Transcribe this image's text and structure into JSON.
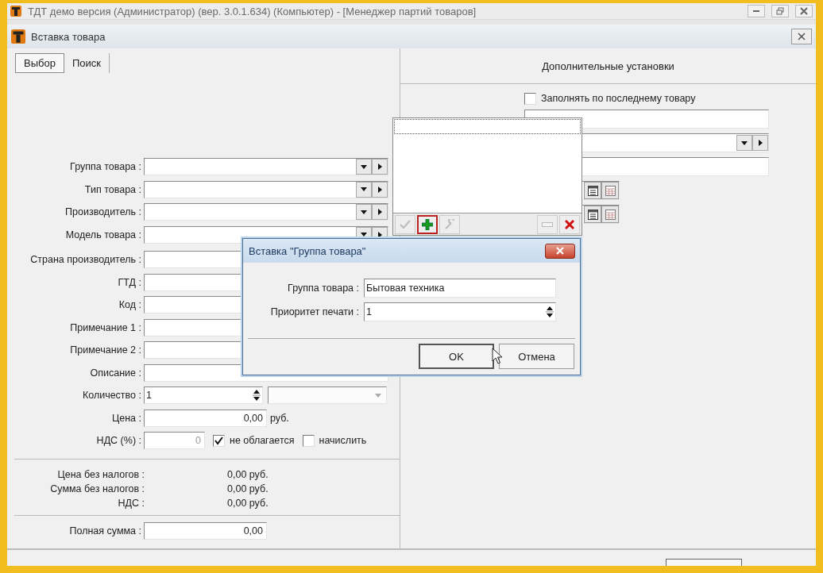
{
  "app_window": {
    "title": "ТДТ демо версия  (Администратор) (вер. 3.0.1.634) (Компьютер) - [Менеджер партий товаров]"
  },
  "dialog": {
    "title": "Вставка товара"
  },
  "tabs": [
    {
      "label": "Выбор",
      "selected": true
    },
    {
      "label": "Поиск",
      "selected": false
    }
  ],
  "form_fields": [
    {
      "label": "Группа товара :",
      "kind": "combo"
    },
    {
      "label": "Тип товара :",
      "kind": "combo"
    },
    {
      "label": "Производитель :",
      "kind": "combo"
    },
    {
      "label": "Модель товара :",
      "kind": "combo"
    },
    {
      "label": "Страна производитель :",
      "kind": "text"
    },
    {
      "label": "ГТД :",
      "kind": "text"
    },
    {
      "label": "Код :",
      "kind": "text"
    },
    {
      "label": "Примечание 1 :",
      "kind": "text"
    },
    {
      "label": "Примечание 2 :",
      "kind": "text"
    },
    {
      "label": "Описание :",
      "kind": "text"
    },
    {
      "label": "Количество :",
      "kind": "spin",
      "value": "1"
    },
    {
      "label": "Цена :",
      "kind": "money",
      "value": "0,00",
      "unit": "руб."
    },
    {
      "label": "НДС (%) :",
      "kind": "vat",
      "value": "0",
      "disabled": true
    }
  ],
  "vat_options": [
    {
      "label": "не облагается",
      "checked": true
    },
    {
      "label": "начислить",
      "checked": false
    }
  ],
  "totals": [
    {
      "label": "Цена без налогов :",
      "value": "0,00 руб."
    },
    {
      "label": "Сумма без налогов :",
      "value": "0,00 руб."
    },
    {
      "label": "НДС :",
      "value": "0,00 руб."
    }
  ],
  "total_sum": {
    "label": "Полная сумма :",
    "value": "0,00"
  },
  "extra_settings": {
    "title": "Дополнительные установки",
    "fill_from_last": {
      "label": "Заполнять по последнему товару",
      "checked": false
    }
  },
  "popup_toolbar": [
    {
      "kind": "check",
      "disabled": true,
      "selected": false
    },
    {
      "kind": "add",
      "disabled": false,
      "selected": true
    },
    {
      "kind": "edit",
      "disabled": true,
      "selected": false
    },
    {
      "kind": "remove",
      "disabled": true,
      "selected": false
    },
    {
      "kind": "delete",
      "disabled": false,
      "selected": false
    }
  ],
  "insert_dialog": {
    "title": "Вставка \"Группа товара\"",
    "fields": [
      {
        "label": "Группа товара :",
        "kind": "text",
        "value": "Бытовая техника"
      },
      {
        "label": "Приоритет печати :",
        "kind": "spin",
        "value": "1"
      }
    ],
    "buttons": [
      {
        "label": "OK",
        "default": true
      },
      {
        "label": "Отмена",
        "default": false
      }
    ]
  }
}
